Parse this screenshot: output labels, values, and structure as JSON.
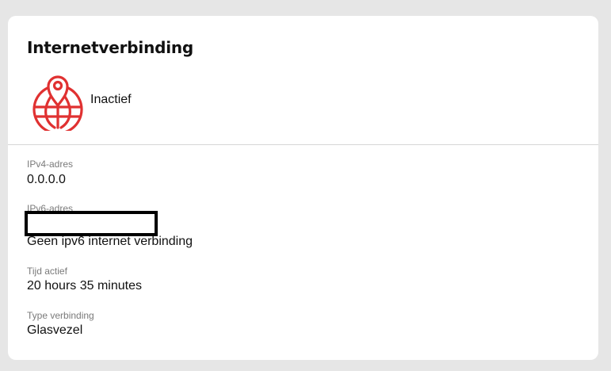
{
  "panel": {
    "title": "Internetverbinding",
    "status": "Inactief",
    "status_icon": "globe-location-pin-icon",
    "accent_color": "#e03131"
  },
  "fields": [
    {
      "label": "IPv4-adres",
      "value": "0.0.0.0"
    },
    {
      "label": "IPv6-adres",
      "value": "Geen ipv6 internet verbinding"
    },
    {
      "label": "Tijd actief",
      "value": "20 hours 35 minutes"
    },
    {
      "label": "Type verbinding",
      "value": "Glasvezel"
    }
  ]
}
